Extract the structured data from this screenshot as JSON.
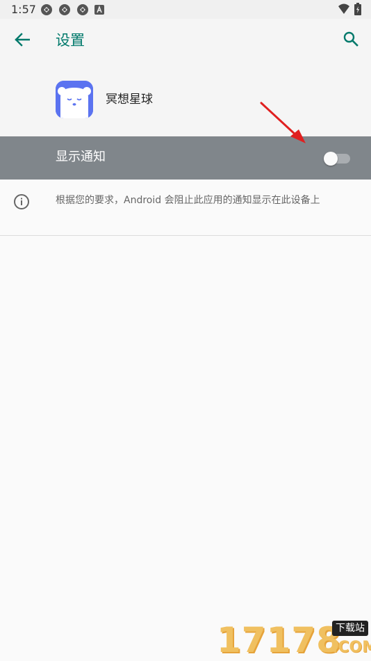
{
  "status_bar": {
    "time": "1:57",
    "left_icons": [
      "sync-icon",
      "sync-icon",
      "sync-icon",
      "a-badge-icon"
    ],
    "right_icons": [
      "wifi-icon",
      "battery-icon"
    ]
  },
  "app_bar": {
    "title": "设置",
    "back_icon": "arrow-left-icon",
    "search_icon": "search-icon",
    "accent_color": "#00796b"
  },
  "app": {
    "name": "冥想星球",
    "icon": "bear-face-icon",
    "icon_color": "#5b73f0"
  },
  "notifications": {
    "label": "显示通知",
    "enabled": false,
    "row_color": "#80868b"
  },
  "info": {
    "icon": "info-icon",
    "text": "根据您的要求，Android 会阻止此应用的通知显示在此设备上"
  },
  "watermark": {
    "numbers": "17178",
    "badge": "下载站",
    "suffix": ".COM"
  },
  "annotation": {
    "arrow_color": "#e02020"
  }
}
